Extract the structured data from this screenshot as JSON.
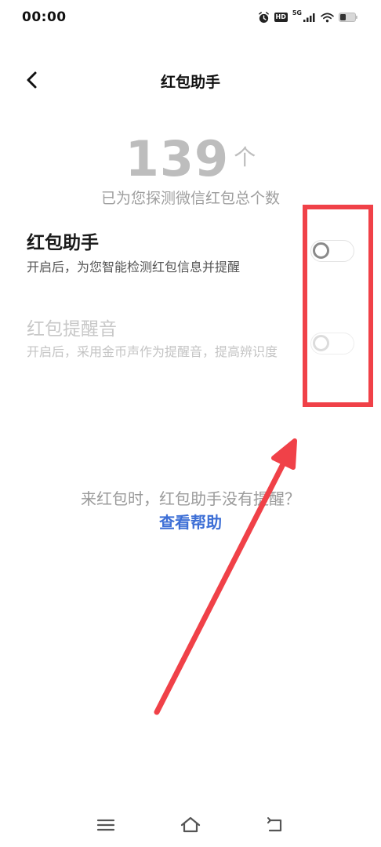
{
  "status_bar": {
    "time": "00:00",
    "hd_label": "HD",
    "network_label": "5G",
    "icons": [
      "alarm-icon",
      "hd-icon",
      "signal-icon",
      "wifi-icon",
      "battery-icon"
    ]
  },
  "header": {
    "title": "红包助手",
    "back_icon": "chevron-left-icon"
  },
  "counter": {
    "value": "139",
    "unit": "个",
    "caption": "已为您探测微信红包总个数"
  },
  "settings": [
    {
      "title": "红包助手",
      "description": "开启后，为您智能检测红包信息并提醒",
      "enabled": false,
      "disabled_style": false
    },
    {
      "title": "红包提醒音",
      "description": "开启后，采用金币声作为提醒音，提高辨识度",
      "enabled": false,
      "disabled_style": true
    }
  ],
  "help": {
    "question": "来红包时，红包助手没有提醒？",
    "link": "查看帮助"
  },
  "nav_bar": {
    "icons": [
      "menu-icon",
      "home-icon",
      "back-icon"
    ]
  },
  "colors": {
    "annotation_red": "#f04148",
    "link_blue": "#3d6fd6",
    "counter_gray": "#bdbdbd"
  }
}
